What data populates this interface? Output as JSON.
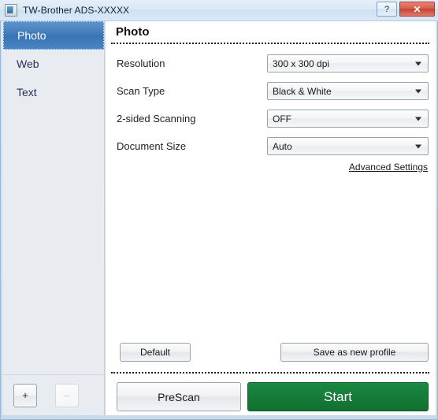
{
  "window": {
    "title": "TW-Brother ADS-XXXXX",
    "app_icon": "scanner-window-icon",
    "help_label": "?",
    "close_label": "✕"
  },
  "sidebar": {
    "items": [
      {
        "label": "Photo",
        "selected": true
      },
      {
        "label": "Web",
        "selected": false
      },
      {
        "label": "Text",
        "selected": false
      }
    ],
    "footer": {
      "add_label": "+",
      "remove_label": "–"
    }
  },
  "main": {
    "panel_title": "Photo",
    "settings": [
      {
        "label": "Resolution",
        "value": "300 x 300 dpi"
      },
      {
        "label": "Scan Type",
        "value": "Black & White"
      },
      {
        "label": "2-sided Scanning",
        "value": "OFF"
      },
      {
        "label": "Document Size",
        "value": "Auto"
      }
    ],
    "advanced_settings_label": "Advanced Settings",
    "buttons": {
      "default_label": "Default",
      "save_profile_label": "Save as new profile",
      "prescan_label": "PreScan",
      "start_label": "Start"
    }
  },
  "colors": {
    "accent_blue": "#3f79ba",
    "start_green": "#157a38",
    "close_red": "#c4402f",
    "sidebar_bg": "#e8ebef",
    "sidebar_text": "#2e2e5c"
  }
}
